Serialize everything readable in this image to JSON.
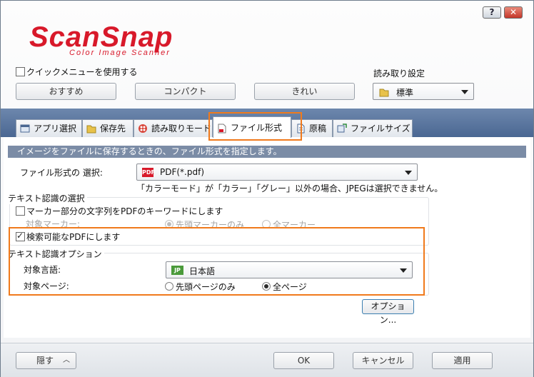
{
  "titlebar": {
    "help_label": "?",
    "close_label": "✕"
  },
  "logo": {
    "text": "ScanSnap",
    "subtitle": "Color Image Scanner",
    "color": "#d8192a"
  },
  "quick_menu": {
    "label": "クイックメニューを使用する",
    "checked": false
  },
  "presets": {
    "recommended": "おすすめ",
    "compact": "コンパクト",
    "clean": "きれい"
  },
  "scan_settings": {
    "label": "読み取り設定",
    "selected": "標準"
  },
  "tabs": [
    {
      "label": "アプリ選択"
    },
    {
      "label": "保存先"
    },
    {
      "label": "読み取りモード"
    },
    {
      "label": "ファイル形式"
    },
    {
      "label": "原稿"
    },
    {
      "label": "ファイルサイズ"
    }
  ],
  "file_format": {
    "description": "イメージをファイルに保存するときの、ファイル形式を指定します。",
    "select_label": "ファイル形式の 選択:",
    "selected": "PDF(*.pdf)",
    "badge": "PDF",
    "note": "「カラーモード」が「カラー」「グレー」以外の場合、JPEGは選択できません。"
  },
  "text_recognition": {
    "group_title": "テキスト認識の選択",
    "marker_label": "マーカー部分の文字列をPDFのキーワードにします",
    "marker_checked": false,
    "target_marker_label": "対象マーカー:",
    "first_marker": "先頭マーカーのみ",
    "all_markers": "全マーカー",
    "searchable_label": "検索可能なPDFにします",
    "searchable_checked": true
  },
  "ocr_options": {
    "group_title": "テキスト認識オプション",
    "language_label": "対象言語:",
    "language_badge": "JP",
    "language": "日本語",
    "pages_label": "対象ページ:",
    "first_page": "先頭ページのみ",
    "all_pages": "全ページ",
    "options_button": "オプション..."
  },
  "footer": {
    "hide": "隠す",
    "ok": "OK",
    "cancel": "キャンセル",
    "apply": "適用"
  },
  "colors": {
    "accent_highlight": "#f07a1c",
    "tab_band": "#5a76a0",
    "description_bar": "#7b8ca6"
  }
}
